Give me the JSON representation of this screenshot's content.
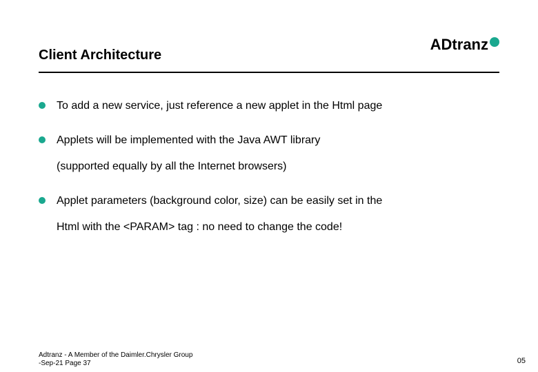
{
  "title": "Client Architecture",
  "logo": {
    "text": "ADtranz"
  },
  "bullets": [
    {
      "l1": "To add a new service, just reference a new applet in the Html page",
      "l2": ""
    },
    {
      "l1": "Applets will be implemented with the Java AWT library",
      "l2": "(supported equally by all the Internet browsers)"
    },
    {
      "l1": "Applet parameters (background color, size) can be easily set in the",
      "l2": "Html with the <PARAM> tag : no need to change the code!"
    }
  ],
  "footer": {
    "line1": "Adtranz - A Member of the Daimler.Chrysler Group",
    "line2": "-Sep-21  Page 37"
  },
  "page_number": "05"
}
